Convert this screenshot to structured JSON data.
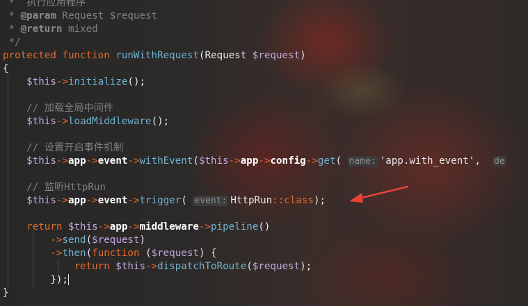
{
  "doc_comment": {
    "line1": " *  执行应用程序",
    "param_tag": "@param",
    "param_rest": " Request $request",
    "return_tag": "@return",
    "return_rest": " mixed",
    "close": " */"
  },
  "signature": {
    "kw1": "protected",
    "kw2": "function",
    "name": "runWithRequest",
    "open": "(",
    "type": "Request",
    "param": "$request",
    "close": ")"
  },
  "brace_open": "{",
  "brace_close": "}",
  "line_init": {
    "this": "$this",
    "arrow": "->",
    "method": "initialize",
    "rest": "();"
  },
  "comment_middleware": "// 加载全局中间件",
  "line_load": {
    "this": "$this",
    "arrow": "->",
    "method": "loadMiddleware",
    "rest": "();"
  },
  "comment_event": "// 设置开启事件机制",
  "line_event": {
    "this": "$this",
    "arrow1": "->",
    "prop1": "app",
    "arrow2": "->",
    "prop2": "event",
    "arrow3": "->",
    "method": "withEvent",
    "open": "(",
    "this2": "$this",
    "arrow4": "->",
    "prop3": "app",
    "arrow5": "->",
    "prop4": "config",
    "arrow6": "->",
    "method2": "get",
    "open2": "(",
    "hint_name": "name:",
    "string": "'app.with_event'",
    "comma": ",",
    "hint_default": "de"
  },
  "comment_listen": "// 监听HttpRun",
  "line_trigger": {
    "this": "$this",
    "arrow1": "->",
    "prop1": "app",
    "arrow2": "->",
    "prop2": "event",
    "arrow3": "->",
    "method": "trigger",
    "open": "(",
    "hint_event": "event:",
    "class_name": "HttpRun",
    "scope": "::",
    "class_kw": "class",
    "close": ");"
  },
  "line_return": {
    "kw": "return",
    "this": "$this",
    "arrow1": "->",
    "prop1": "app",
    "arrow2": "->",
    "prop2": "middleware",
    "arrow3": "->",
    "method": "pipeline",
    "rest": "()"
  },
  "line_send": {
    "arrow": "->",
    "method": "send",
    "open": "(",
    "var": "$request",
    "close": ")"
  },
  "line_then": {
    "arrow": "->",
    "method": "then",
    "open": "(",
    "kw": "function",
    "p_open": " (",
    "var": "$request",
    "p_close": ") {"
  },
  "line_dispatch": {
    "kw": "return",
    "this": "$this",
    "arrow": "->",
    "method": "dispatchToRoute",
    "open": "(",
    "var": "$request",
    "close": ");"
  },
  "line_end_then": "});",
  "colors": {
    "keyword": "#e36a2f",
    "method": "#6fb3d2",
    "variable": "#c3a8e0",
    "comment": "#7f7f7f",
    "annotation_arrow": "#e8433a"
  }
}
